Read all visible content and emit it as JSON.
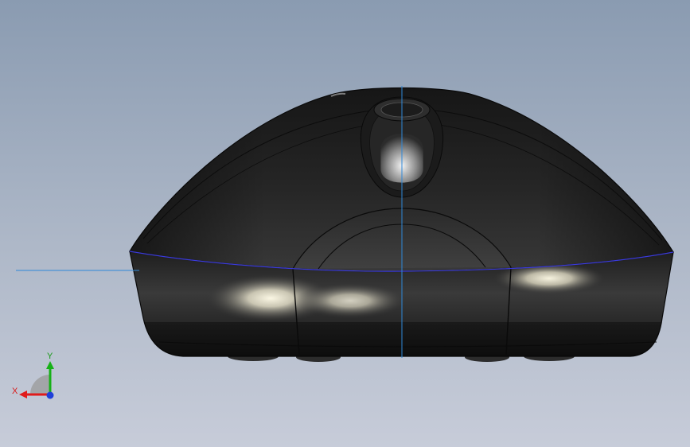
{
  "viewport": {
    "background_top": "#8a9bb1",
    "background_bottom": "#c7ccd9"
  },
  "model": {
    "name": "computer-mouse-front-view",
    "body_color": "#242424",
    "highlight_color": "#f4f1de",
    "edge_color": "#0a0a0a",
    "crosshair_color": "#2f88d8",
    "seam_color": "#3b3bd8"
  },
  "triad": {
    "x_label": "X",
    "y_label": "Y",
    "x_color": "#e01b1b",
    "y_color": "#17b117",
    "z_color": "#1f3fd9"
  }
}
